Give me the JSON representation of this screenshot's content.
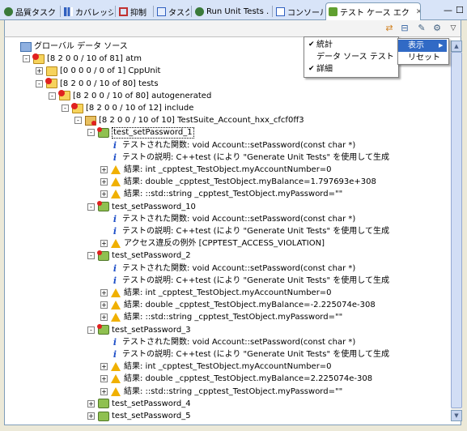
{
  "tabs": [
    {
      "label": "品質タスク",
      "icon_color": "#3a7a3a"
    },
    {
      "label": "カバレッジ",
      "icon_color": "#3060c0"
    },
    {
      "label": "抑制",
      "icon_color": "#c03030"
    },
    {
      "label": "タスク",
      "icon_color": "#3060c0"
    },
    {
      "label": "Run Unit Tests .",
      "icon_color": "#3a7a3a"
    },
    {
      "label": "コンソール",
      "icon_color": "#3060c0"
    },
    {
      "label": "テスト ケース エク",
      "icon_color": "#60a030",
      "active": true,
      "close": "✕"
    }
  ],
  "window_buttons": {
    "minimize": "—",
    "maximize": "☐"
  },
  "toolbar": {
    "icons": [
      "sync-icon",
      "collapse-icon",
      "pin-icon",
      "filter-icon",
      "view-menu-icon"
    ],
    "glyphs": [
      "⇄",
      "⊟",
      "✎",
      "⚙",
      "▽"
    ]
  },
  "tree": [
    {
      "indent": 0,
      "toggle": "",
      "icon": "global",
      "text": "グローバル データ ソース"
    },
    {
      "indent": 1,
      "toggle": "-",
      "icon": "folder-red",
      "text": "[8 2 0 0 / 10 of 81] atm"
    },
    {
      "indent": 2,
      "toggle": "+",
      "icon": "folder",
      "text": "[0 0 0 0 / 0 of 1] CppUnit"
    },
    {
      "indent": 2,
      "toggle": "-",
      "icon": "folder-red",
      "text": "[8 2 0 0 / 10 of 80] tests"
    },
    {
      "indent": 3,
      "toggle": "-",
      "icon": "folder-red",
      "text": "[8 2 0 0 / 10 of 80] autogenerated"
    },
    {
      "indent": 4,
      "toggle": "-",
      "icon": "folder-red",
      "text": "[8 2 0 0 / 10 of 12] include"
    },
    {
      "indent": 5,
      "toggle": "-",
      "icon": "pkg-red",
      "text": "[8 2 0 0 / 10 of 10] TestSuite_Account_hxx_cfcf0ff3"
    },
    {
      "indent": 6,
      "toggle": "-",
      "icon": "tcase-red",
      "text": "test_setPassword_1",
      "selected": true
    },
    {
      "indent": 7,
      "toggle": "",
      "icon": "info",
      "text": "テストされた関数: void Account::setPassword(const char *)"
    },
    {
      "indent": 7,
      "toggle": "",
      "icon": "info",
      "text": "テストの説明: C++test (により \"Generate Unit Tests\" を使用して生成"
    },
    {
      "indent": 7,
      "toggle": "+",
      "icon": "warn",
      "text": "結果: int _cpptest_TestObject.myAccountNumber=0"
    },
    {
      "indent": 7,
      "toggle": "+",
      "icon": "warn",
      "text": "結果: double _cpptest_TestObject.myBalance=1.797693e+308"
    },
    {
      "indent": 7,
      "toggle": "+",
      "icon": "warn",
      "text": "結果: ::std::string _cpptest_TestObject.myPassword=\"\""
    },
    {
      "indent": 6,
      "toggle": "-",
      "icon": "tcase-red",
      "text": "test_setPassword_10"
    },
    {
      "indent": 7,
      "toggle": "",
      "icon": "info",
      "text": "テストされた関数: void Account::setPassword(const char *)"
    },
    {
      "indent": 7,
      "toggle": "",
      "icon": "info",
      "text": "テストの説明: C++test (により \"Generate Unit Tests\" を使用して生成"
    },
    {
      "indent": 7,
      "toggle": "+",
      "icon": "warn",
      "text": "アクセス違反の例外 [CPPTEST_ACCESS_VIOLATION]"
    },
    {
      "indent": 6,
      "toggle": "-",
      "icon": "tcase-red",
      "text": "test_setPassword_2"
    },
    {
      "indent": 7,
      "toggle": "",
      "icon": "info",
      "text": "テストされた関数: void Account::setPassword(const char *)"
    },
    {
      "indent": 7,
      "toggle": "",
      "icon": "info",
      "text": "テストの説明: C++test (により \"Generate Unit Tests\" を使用して生成"
    },
    {
      "indent": 7,
      "toggle": "+",
      "icon": "warn",
      "text": "結果: int _cpptest_TestObject.myAccountNumber=0"
    },
    {
      "indent": 7,
      "toggle": "+",
      "icon": "warn",
      "text": "結果: double _cpptest_TestObject.myBalance=-2.225074e-308"
    },
    {
      "indent": 7,
      "toggle": "+",
      "icon": "warn",
      "text": "結果: ::std::string _cpptest_TestObject.myPassword=\"\""
    },
    {
      "indent": 6,
      "toggle": "-",
      "icon": "tcase-red",
      "text": "test_setPassword_3"
    },
    {
      "indent": 7,
      "toggle": "",
      "icon": "info",
      "text": "テストされた関数: void Account::setPassword(const char *)"
    },
    {
      "indent": 7,
      "toggle": "",
      "icon": "info",
      "text": "テストの説明: C++test (により \"Generate Unit Tests\" を使用して生成"
    },
    {
      "indent": 7,
      "toggle": "+",
      "icon": "warn",
      "text": "結果: int _cpptest_TestObject.myAccountNumber=0"
    },
    {
      "indent": 7,
      "toggle": "+",
      "icon": "warn",
      "text": "結果: double _cpptest_TestObject.myBalance=2.225074e-308"
    },
    {
      "indent": 7,
      "toggle": "+",
      "icon": "warn",
      "text": "結果: ::std::string _cpptest_TestObject.myPassword=\"\""
    },
    {
      "indent": 6,
      "toggle": "+",
      "icon": "tcase",
      "text": "test_setPassword_4"
    },
    {
      "indent": 6,
      "toggle": "+",
      "icon": "tcase",
      "text": "test_setPassword_5"
    }
  ],
  "context_menu": {
    "items": [
      {
        "label": "統計",
        "checked": "✔"
      },
      {
        "label": "データ ソース テスト",
        "checked": ""
      },
      {
        "label": "詳細",
        "checked": "✔"
      }
    ]
  },
  "submenu": {
    "header": "表示",
    "header_arrow": "▶",
    "items": [
      {
        "label": "リセット"
      }
    ]
  },
  "scroll_arrows": {
    "up": "▲",
    "down": "▼"
  },
  "colors": {
    "selection": "#ffffff",
    "highlight": "#316ac5",
    "accent": "#7f9db9"
  }
}
